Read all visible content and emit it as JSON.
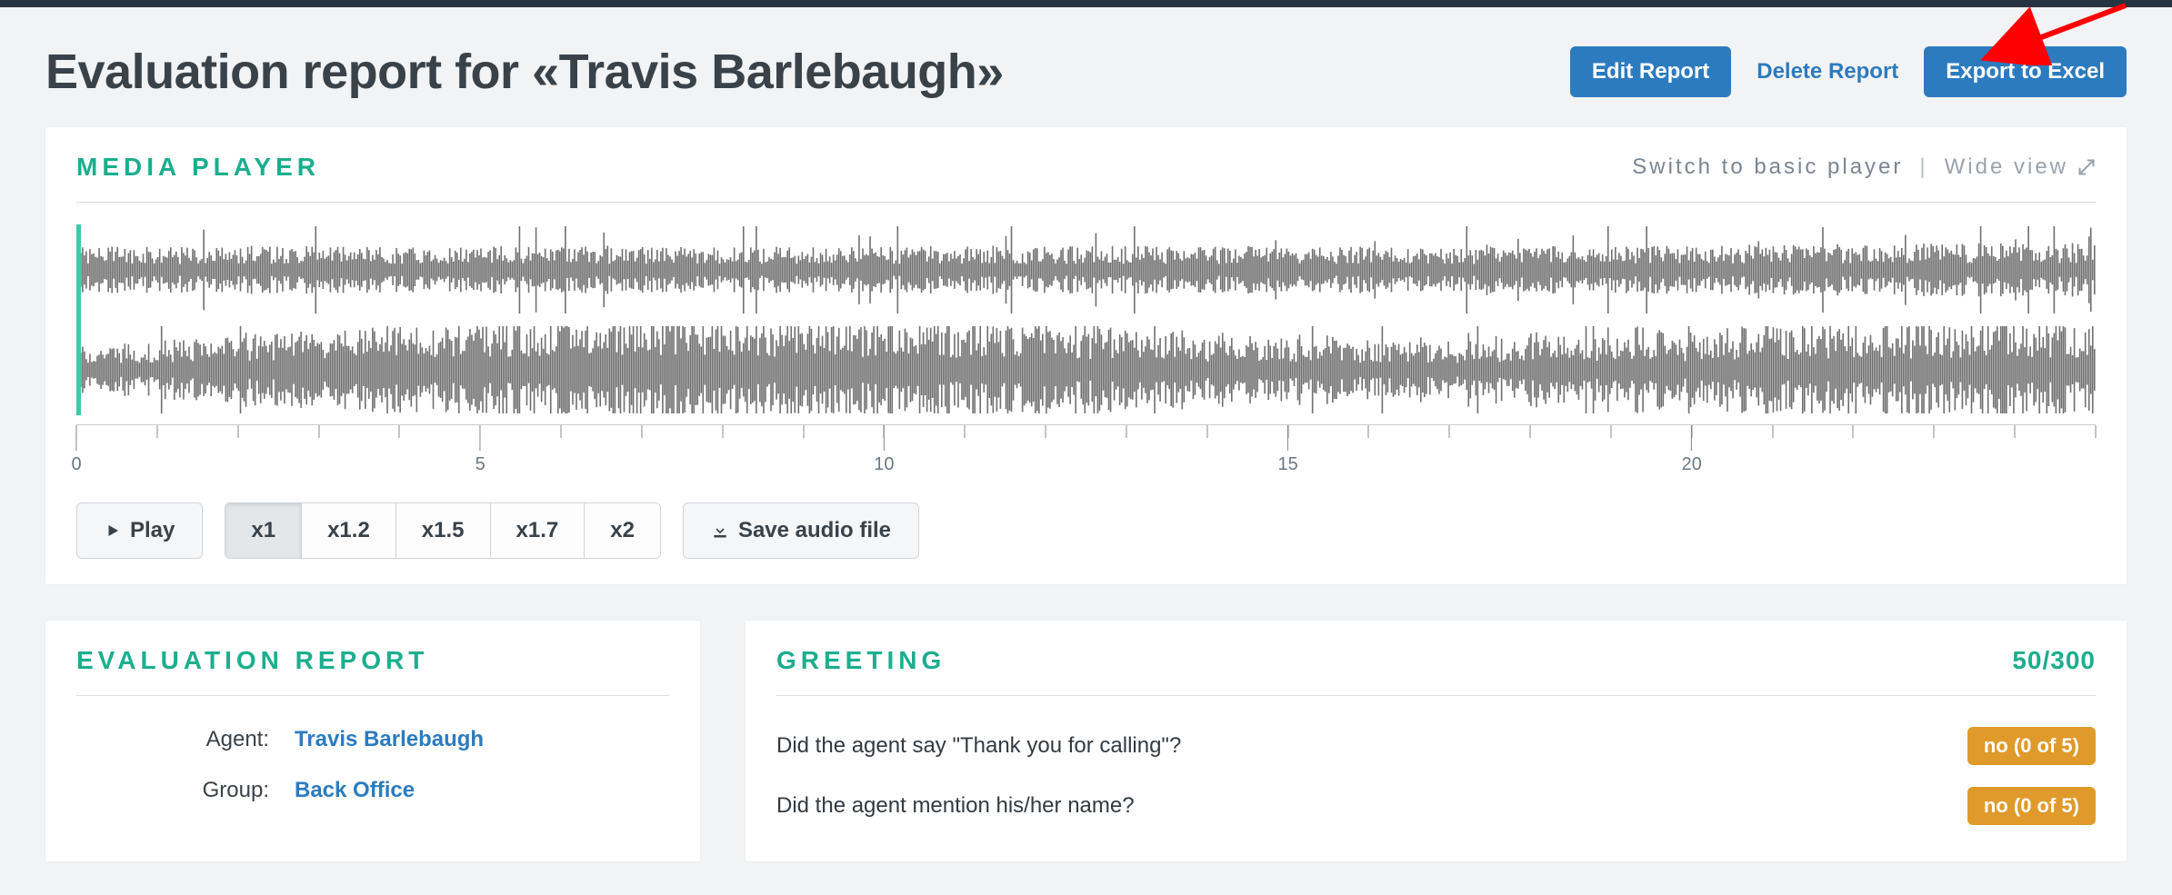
{
  "header": {
    "title": "Evaluation report for «Travis Barlebaugh»",
    "edit": "Edit Report",
    "delete": "Delete Report",
    "export": "Export to Excel"
  },
  "media_player": {
    "title": "MEDIA PLAYER",
    "switch_link": "Switch to basic player",
    "wide_link": "Wide view",
    "play": "Play",
    "save": "Save audio file",
    "speeds": [
      "x1",
      "x1.2",
      "x1.5",
      "x1.7",
      "x2"
    ],
    "active_speed_index": 0,
    "timeline_marks": [
      "0",
      "5",
      "10",
      "15",
      "20"
    ]
  },
  "evaluation_report": {
    "title": "EVALUATION REPORT",
    "rows": [
      {
        "label": "Agent:",
        "value": "Travis Barlebaugh"
      },
      {
        "label": "Group:",
        "value": "Back Office"
      }
    ]
  },
  "greeting": {
    "title": "GREETING",
    "score": "50/300",
    "questions": [
      {
        "text": "Did the agent say \"Thank you for calling\"?",
        "answer": "no (0 of 5)"
      },
      {
        "text": "Did the agent mention his/her name?",
        "answer": "no (0 of 5)"
      }
    ]
  }
}
